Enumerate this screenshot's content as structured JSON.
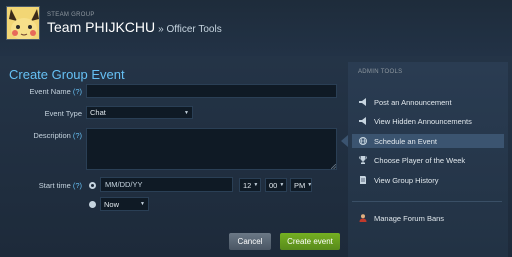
{
  "header": {
    "group_kind": "STEAM GROUP",
    "group_name": "Team PHIJKCHU",
    "section": "» Officer Tools"
  },
  "form": {
    "title": "Create Group Event",
    "help": "(?)",
    "event_name_label": "Event Name",
    "event_name_value": "",
    "event_type_label": "Event Type",
    "event_type_value": "Chat",
    "description_label": "Description",
    "description_value": "",
    "start_time_label": "Start time",
    "date_placeholder": "MM/DD/YY",
    "hour": "12",
    "minute": "00",
    "ampm": "PM",
    "now_option": "Now",
    "cancel_label": "Cancel",
    "create_label": "Create event"
  },
  "sidebar": {
    "title": "ADMIN TOOLS",
    "items": [
      {
        "label": "Post an Announcement",
        "icon": "megaphone-icon"
      },
      {
        "label": "View Hidden Announcements",
        "icon": "megaphone-icon"
      },
      {
        "label": "Schedule an Event",
        "icon": "globe-icon",
        "active": true
      },
      {
        "label": "Choose Player of the Week",
        "icon": "trophy-icon"
      },
      {
        "label": "View Group History",
        "icon": "history-icon"
      },
      {
        "label": "Manage Forum Bans",
        "icon": "user-ban-icon"
      }
    ]
  },
  "colors": {
    "accent": "#66c0f4",
    "create_button": "#75b022",
    "background": "#1b2838"
  }
}
